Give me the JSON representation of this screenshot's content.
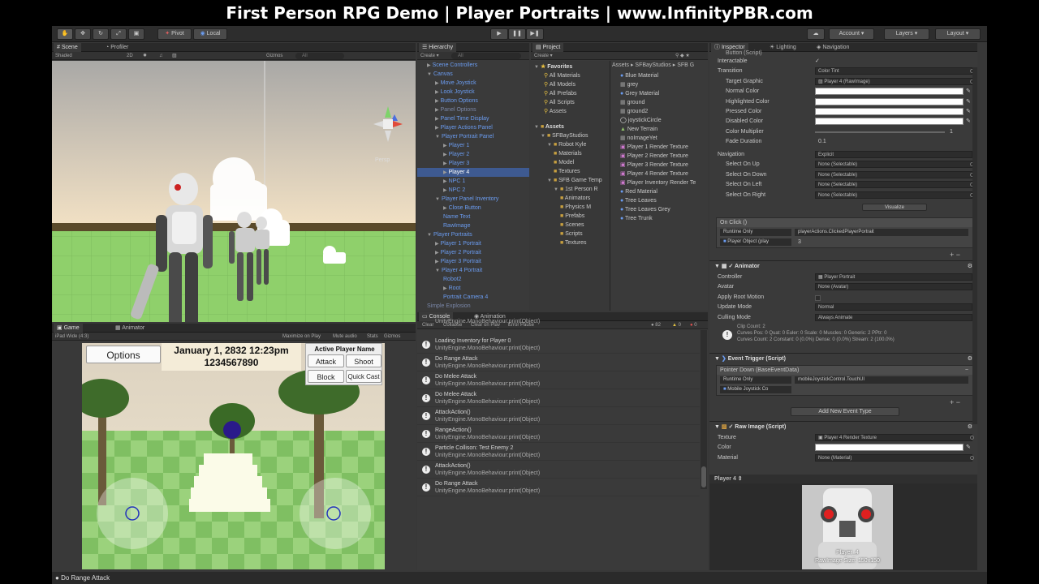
{
  "banner": {
    "title": "First Person RPG Demo | Player Portraits | www.InfinityPBR.com"
  },
  "toolbar": {
    "pivot": "Pivot",
    "local": "Local",
    "account": "Account",
    "layers": "Layers",
    "layout": "Layout"
  },
  "scene": {
    "tabs": [
      "Scene",
      "Profiler"
    ],
    "shading": "Shaded",
    "mode2d": "2D",
    "gizmos": "Gizmos",
    "search_placeholder": "All",
    "persp": "Persp"
  },
  "game": {
    "tabs": [
      "Game",
      "Animator"
    ],
    "resolution": "iPad Wide (4:3)",
    "toggles": [
      "Maximize on Play",
      "Mute audio",
      "Stats",
      "Gizmos"
    ],
    "hud": {
      "options": "Options",
      "date": "January 1, 2832 12:23pm",
      "number": "1234567890",
      "active_player": "Active Player Name",
      "attack": "Attack",
      "shoot": "Shoot",
      "block": "Block",
      "quick_cast": "Quick Cast"
    }
  },
  "hierarchy": {
    "tab": "Hierarchy",
    "create": "Create",
    "search_placeholder": "All",
    "items": [
      {
        "label": "Scene Controllers",
        "indent": 1,
        "style": "blue",
        "arrow": "▶"
      },
      {
        "label": "Canvas",
        "indent": 1,
        "style": "blue",
        "arrow": "▼"
      },
      {
        "label": "Move Joystick",
        "indent": 2,
        "style": "blue",
        "arrow": "▶"
      },
      {
        "label": "Look Joystick",
        "indent": 2,
        "style": "blue",
        "arrow": "▶"
      },
      {
        "label": "Button Options",
        "indent": 2,
        "style": "blue",
        "arrow": "▶"
      },
      {
        "label": "Panel Options",
        "indent": 2,
        "style": "gray",
        "arrow": "▶"
      },
      {
        "label": "Panel Time Display",
        "indent": 2,
        "style": "blue",
        "arrow": "▶"
      },
      {
        "label": "Player Actions Panel",
        "indent": 2,
        "style": "blue",
        "arrow": "▶"
      },
      {
        "label": "Player Portrait Panel",
        "indent": 2,
        "style": "blue",
        "arrow": "▼"
      },
      {
        "label": "Player 1",
        "indent": 3,
        "style": "blue",
        "arrow": "▶"
      },
      {
        "label": "Player 2",
        "indent": 3,
        "style": "blue",
        "arrow": "▶"
      },
      {
        "label": "Player 3",
        "indent": 3,
        "style": "blue",
        "arrow": "▶"
      },
      {
        "label": "Player 4",
        "indent": 3,
        "style": "sel",
        "arrow": "▶"
      },
      {
        "label": "NPC 1",
        "indent": 3,
        "style": "blue",
        "arrow": "▶"
      },
      {
        "label": "NPC 2",
        "indent": 3,
        "style": "blue",
        "arrow": "▶"
      },
      {
        "label": "Player Panel Inventory",
        "indent": 2,
        "style": "blue",
        "arrow": "▼"
      },
      {
        "label": "Close Button",
        "indent": 3,
        "style": "blue",
        "arrow": "▶"
      },
      {
        "label": "Name Text",
        "indent": 3,
        "style": "blue",
        "arrow": ""
      },
      {
        "label": "RawImage",
        "indent": 3,
        "style": "blue",
        "arrow": ""
      },
      {
        "label": "Player Portraits",
        "indent": 1,
        "style": "blue",
        "arrow": "▼"
      },
      {
        "label": "Player 1 Portrait",
        "indent": 2,
        "style": "blue",
        "arrow": "▶"
      },
      {
        "label": "Player 2 Portrait",
        "indent": 2,
        "style": "blue",
        "arrow": "▶"
      },
      {
        "label": "Player 3 Portrait",
        "indent": 2,
        "style": "blue",
        "arrow": "▶"
      },
      {
        "label": "Player 4 Portrait",
        "indent": 2,
        "style": "blue",
        "arrow": "▼"
      },
      {
        "label": "Robot2",
        "indent": 3,
        "style": "blue",
        "arrow": ""
      },
      {
        "label": "Root",
        "indent": 3,
        "style": "blue",
        "arrow": "▶"
      },
      {
        "label": "Portrait Camera 4",
        "indent": 3,
        "style": "blue",
        "arrow": ""
      },
      {
        "label": "Simple Explosion",
        "indent": 1,
        "style": "gray",
        "arrow": ""
      }
    ]
  },
  "project": {
    "tab": "Project",
    "create": "Create",
    "favorites": {
      "title": "Favorites",
      "items": [
        "All Materials",
        "All Models",
        "All Prefabs",
        "All Scripts",
        "Assets"
      ]
    },
    "assets": {
      "title": "Assets",
      "tree": [
        {
          "label": "SFBayStudios",
          "indent": 1,
          "arrow": "▼"
        },
        {
          "label": "Robot Kyle",
          "indent": 2,
          "arrow": "▼"
        },
        {
          "label": "Materials",
          "indent": 3,
          "arrow": ""
        },
        {
          "label": "Model",
          "indent": 3,
          "arrow": ""
        },
        {
          "label": "Textures",
          "indent": 3,
          "arrow": ""
        },
        {
          "label": "SFB Game Temp",
          "indent": 2,
          "arrow": "▼"
        },
        {
          "label": "1st Person R",
          "indent": 3,
          "arrow": "▼"
        },
        {
          "label": "Animators",
          "indent": 4,
          "arrow": ""
        },
        {
          "label": "Physics M",
          "indent": 4,
          "arrow": ""
        },
        {
          "label": "Prefabs",
          "indent": 4,
          "arrow": ""
        },
        {
          "label": "Scenes",
          "indent": 4,
          "arrow": ""
        },
        {
          "label": "Scripts",
          "indent": 4,
          "arrow": ""
        },
        {
          "label": "Textures",
          "indent": 4,
          "arrow": ""
        }
      ]
    },
    "breadcrumb": [
      "Assets",
      "SFBayStudios",
      "SFB G"
    ],
    "files": [
      {
        "label": "Blue Material",
        "icon": "material-icon"
      },
      {
        "label": "grey",
        "icon": "texture-icon"
      },
      {
        "label": "Grey Material",
        "icon": "material-icon"
      },
      {
        "label": "ground",
        "icon": "texture-icon"
      },
      {
        "label": "ground2",
        "icon": "texture-icon"
      },
      {
        "label": "joystickCircle",
        "icon": "circle-icon"
      },
      {
        "label": "New Terrain",
        "icon": "terrain-icon"
      },
      {
        "label": "noImageYet",
        "icon": "texture-icon"
      },
      {
        "label": "Player 1 Render Texture",
        "icon": "render-texture-icon"
      },
      {
        "label": "Player 2 Render Texture",
        "icon": "render-texture-icon"
      },
      {
        "label": "Player 3 Render Texture",
        "icon": "render-texture-icon"
      },
      {
        "label": "Player 4 Render Texture",
        "icon": "render-texture-icon"
      },
      {
        "label": "Player Inventory Render Te",
        "icon": "render-texture-icon"
      },
      {
        "label": "Red Material",
        "icon": "material-icon"
      },
      {
        "label": "Tree Leaves",
        "icon": "material-icon"
      },
      {
        "label": "Tree Leaves Grey",
        "icon": "material-icon"
      },
      {
        "label": "Tree Trunk",
        "icon": "material-icon"
      }
    ]
  },
  "console": {
    "tabs": [
      "Console",
      "Animation"
    ],
    "buttons": [
      "Clear",
      "Collapse",
      "Clear on Play",
      "Error Pause"
    ],
    "counts": {
      "log": "82",
      "warn": "0",
      "error": "0"
    },
    "entries": [
      {
        "l1": "",
        "l2": "UnityEngine.MonoBehaviour:print(Object)"
      },
      {
        "l1": "Loading Inventory for Player 0",
        "l2": "UnityEngine.MonoBehaviour:print(Object)"
      },
      {
        "l1": "Do Range Attack",
        "l2": "UnityEngine.MonoBehaviour:print(Object)"
      },
      {
        "l1": "Do Melee Attack",
        "l2": "UnityEngine.MonoBehaviour:print(Object)"
      },
      {
        "l1": "Do Melee Attack",
        "l2": "UnityEngine.MonoBehaviour:print(Object)"
      },
      {
        "l1": "AttackAction()",
        "l2": "UnityEngine.MonoBehaviour:print(Object)"
      },
      {
        "l1": "RangeAction()",
        "l2": "UnityEngine.MonoBehaviour:print(Object)"
      },
      {
        "l1": "Particle Collison: Test Enemy 2",
        "l2": "UnityEngine.MonoBehaviour:print(Object)"
      },
      {
        "l1": "AttackAction()",
        "l2": "UnityEngine.MonoBehaviour:print(Object)"
      },
      {
        "l1": "Do Range Attack",
        "l2": "UnityEngine.MonoBehaviour:print(Object)"
      }
    ]
  },
  "inspector": {
    "tabs": [
      "Inspector",
      "Lighting",
      "Navigation"
    ],
    "button_header": "Button (Script)",
    "fields": [
      {
        "label": "Interactable",
        "kind": "check",
        "value": "✓",
        "indent": 1
      },
      {
        "label": "Transition",
        "kind": "dropdown",
        "value": "Color Tint",
        "indent": 1
      },
      {
        "label": "Target Graphic",
        "kind": "field",
        "value": "Player 4 (RawImage)",
        "indent": 2
      },
      {
        "label": "Normal Color",
        "kind": "color",
        "value": "",
        "indent": 2
      },
      {
        "label": "Highlighted Color",
        "kind": "color",
        "value": "",
        "indent": 2
      },
      {
        "label": "Pressed Color",
        "kind": "color",
        "value": "",
        "indent": 2
      },
      {
        "label": "Disabled Color",
        "kind": "color",
        "value": "",
        "indent": 2
      },
      {
        "label": "Color Multiplier",
        "kind": "slider",
        "value": "1",
        "indent": 2
      },
      {
        "label": "Fade Duration",
        "kind": "text",
        "value": "0.1",
        "indent": 2
      }
    ],
    "navigation": [
      {
        "label": "Navigation",
        "value": "Explicit",
        "indent": 1
      },
      {
        "label": "Select On Up",
        "value": "None (Selectable)",
        "indent": 2
      },
      {
        "label": "Select On Down",
        "value": "None (Selectable)",
        "indent": 2
      },
      {
        "label": "Select On Left",
        "value": "None (Selectable)",
        "indent": 2
      },
      {
        "label": "Select On Right",
        "value": "None (Selectable)",
        "indent": 2
      }
    ],
    "visualize": "Visualize",
    "on_click": {
      "title": "On Click ()",
      "mode": "Runtime Only",
      "function": "playerActions.ClickedPlayerPortrait",
      "object": "Player Object (play",
      "arg": "3"
    },
    "animator": {
      "title": "Animator",
      "rows": [
        {
          "label": "Controller",
          "value": "Player Portrait"
        },
        {
          "label": "Avatar",
          "value": "None (Avatar)"
        },
        {
          "label": "Apply Root Motion",
          "value": ""
        },
        {
          "label": "Update Mode",
          "value": "Normal"
        },
        {
          "label": "Culling Mode",
          "value": "Always Animate"
        }
      ],
      "info1": "Clip Count: 2",
      "info2": "Curves Pos: 0 Quat: 0 Euler: 0 Scale: 0 Muscles: 0 Generic: 2 PPtr: 0",
      "info3": "Curves Count: 2 Constant: 0 (0.0%) Dense: 0 (0.0%) Stream: 2 (100.0%)"
    },
    "event_trigger": {
      "title": "Event Trigger (Script)",
      "event": "Pointer Down (BaseEventData)",
      "mode": "Runtime Only",
      "function": "mobileJoystickControl.TouchUI",
      "object": "Mobile Joystick Co",
      "add": "Add New Event Type"
    },
    "raw_image": {
      "title": "Raw Image (Script)",
      "rows": [
        {
          "label": "Texture",
          "value": "Player 4 Render Texture"
        },
        {
          "label": "Color",
          "value": ""
        },
        {
          "label": "Material",
          "value": "None (Material)"
        }
      ]
    },
    "preview": {
      "title": "Player 4",
      "name": "Player_4",
      "size": "RawImage Size: 150x150"
    }
  },
  "status": {
    "text": "Do Range Attack"
  },
  "colors": {
    "selection": "#3e5a91",
    "blue_text": "#6b9cf0",
    "ground": "#86c36a",
    "sky": "#e9ddc8"
  }
}
